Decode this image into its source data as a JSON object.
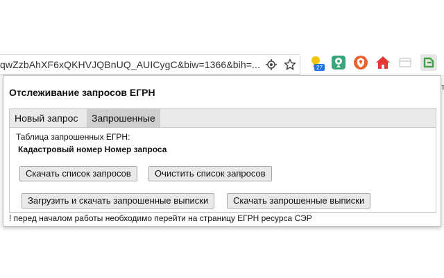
{
  "browser": {
    "url": "qwZzbAhXF6xQKHVJQBnUQ_AUICygC&biw=1366&bih=...",
    "extension_badge": "27"
  },
  "popup": {
    "title": "Отслеживание запросов ЕГРН",
    "tabs": [
      {
        "label": "Новый запрос",
        "active": false
      },
      {
        "label": "Запрошенные",
        "active": true
      }
    ],
    "table_caption": "Таблица запрошенных ЕГРН:",
    "table_columns": "Кадастровый номер Номер запроса",
    "buttons": {
      "download_list": "Скачать список запросов",
      "clear_list": "Очистить список запросов",
      "load_and_download": "Загрузить и скачать запрошенные выписки",
      "download_extracts": "Скачать запрошенные выписки"
    },
    "note": "! перед началом работы необходимо перейти на страницу ЕГРН ресурса СЭР"
  },
  "colors": {
    "accent_blue": "#1a73e8",
    "ext_green": "#3aa57a",
    "ext_orange": "#e8642c",
    "ext_red": "#e53935"
  }
}
